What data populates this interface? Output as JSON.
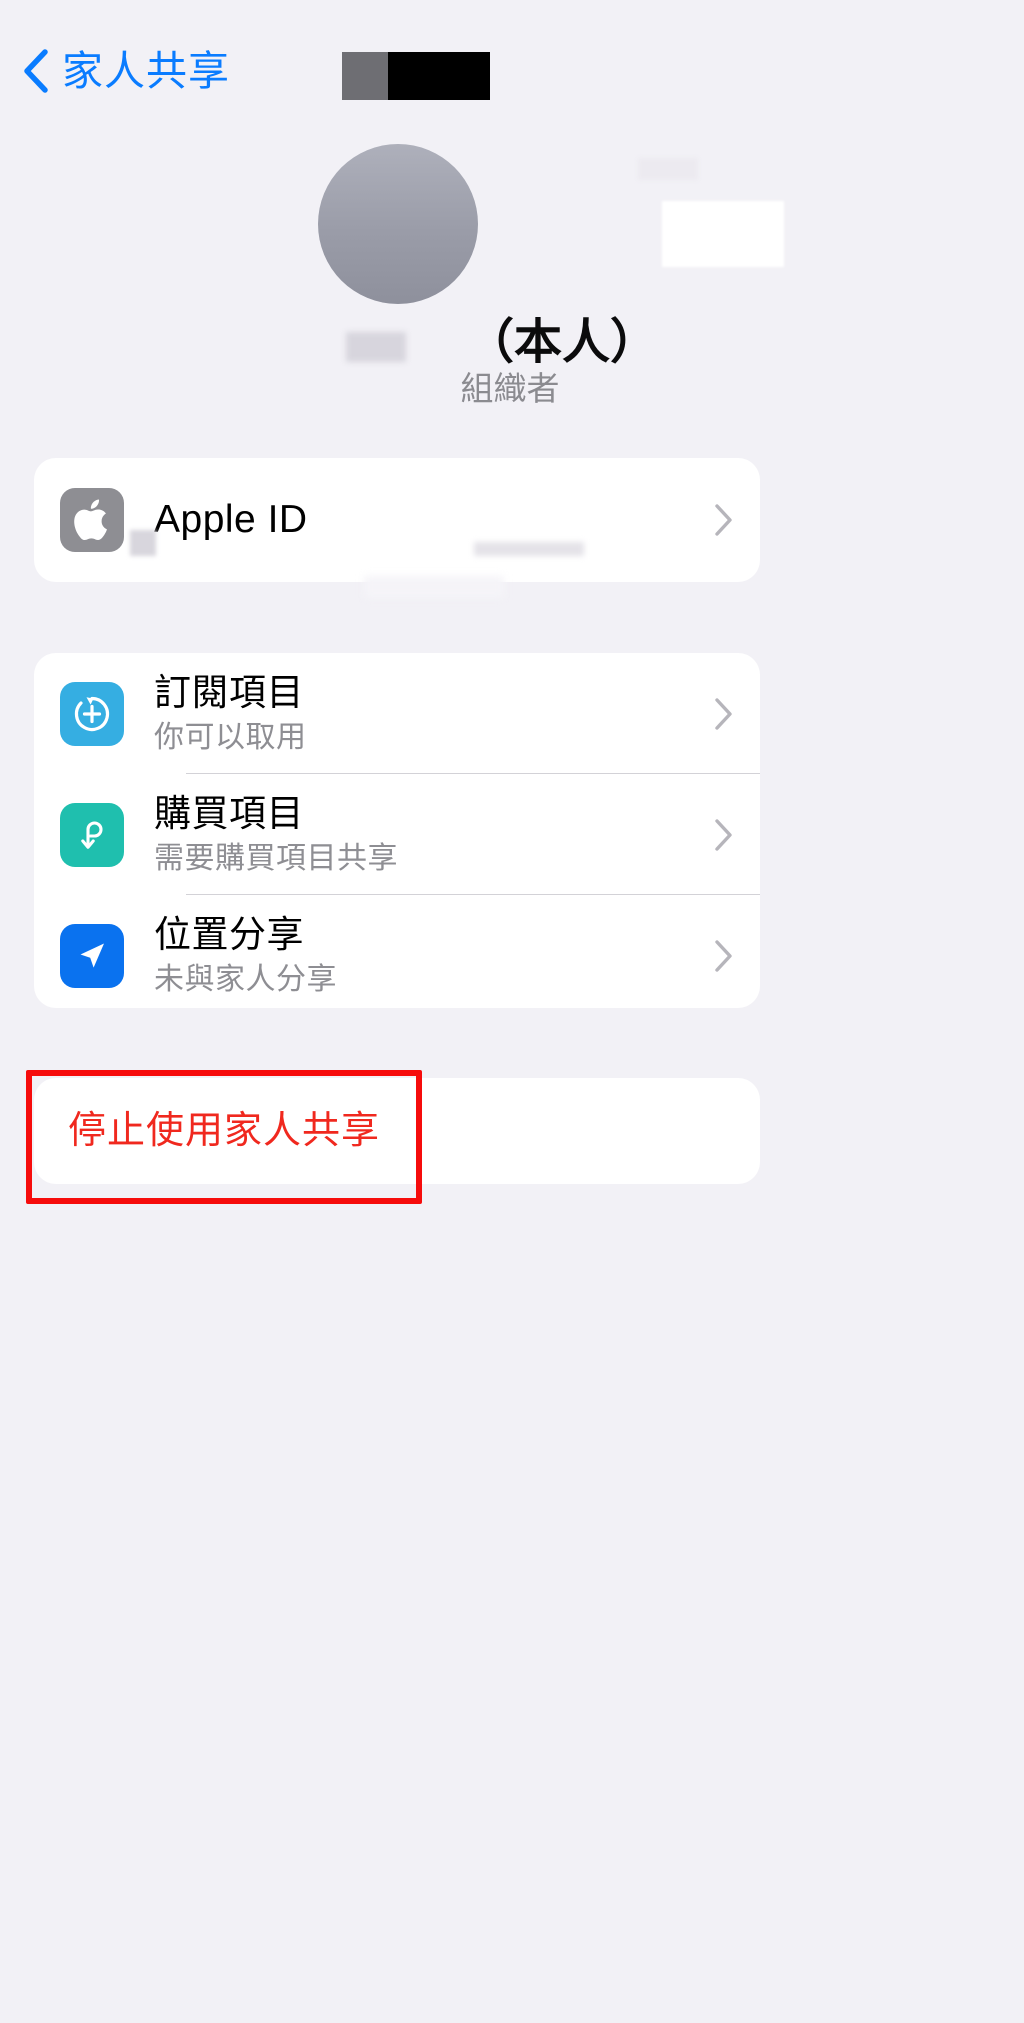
{
  "navbar": {
    "back_label": "家人共享",
    "back_icon": "chevron-left-icon",
    "redaction_label": ""
  },
  "profile": {
    "avatar_icon": "user-avatar",
    "name_redacted": "",
    "self_suffix": "（本人）",
    "role": "組織者"
  },
  "account_card": {
    "icon": "apple-logo-icon",
    "title": "Apple ID",
    "chevron": "chevron-right-icon"
  },
  "features_card": {
    "rows": [
      {
        "icon": "subscriptions-icon",
        "title": "訂閱項目",
        "subtitle": "你可以取用",
        "chevron": "chevron-right-icon"
      },
      {
        "icon": "purchases-icon",
        "title": "購買項目",
        "subtitle": "需要購買項目共享",
        "chevron": "chevron-right-icon"
      },
      {
        "icon": "location-sharing-icon",
        "title": "位置分享",
        "subtitle": "未與家人分享",
        "chevron": "chevron-right-icon"
      }
    ]
  },
  "stop_card": {
    "label": "停止使用家人共享"
  },
  "annotation": {
    "type": "highlight-rectangle",
    "color": "#f60c0c"
  },
  "colors": {
    "background": "#f2f1f6",
    "card": "#ffffff",
    "accent_blue": "#0a7cff",
    "destructive_red": "#f0281e",
    "secondary_text": "#8e8e93",
    "icon_apple": "#8e8e93",
    "icon_subscriptions": "#35aee2",
    "icon_purchases": "#1fbfae",
    "icon_location": "#0a72ef",
    "annotation_red": "#f60c0c"
  }
}
